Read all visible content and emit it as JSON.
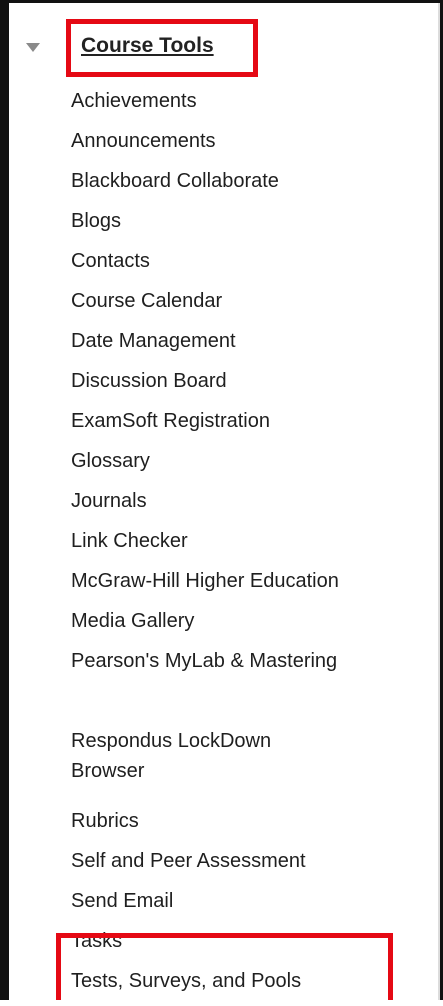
{
  "section": {
    "title": "Course Tools",
    "items": [
      "Achievements",
      "Announcements",
      "Blackboard Collaborate",
      "Blogs",
      "Contacts",
      "Course Calendar",
      "Date Management",
      "Discussion Board",
      "ExamSoft Registration",
      "Glossary",
      "Journals",
      "Link Checker",
      "McGraw-Hill Higher Education",
      "Media Gallery",
      "Pearson's MyLab & Mastering",
      "Respondus LockDown Browser",
      "Rubrics",
      "Self and Peer Assessment",
      "Send Email",
      "Tasks",
      "Tests, Surveys, and Pools"
    ]
  },
  "accent_color": "#e50914",
  "icons": {
    "collapse": "triangle-down-icon"
  }
}
